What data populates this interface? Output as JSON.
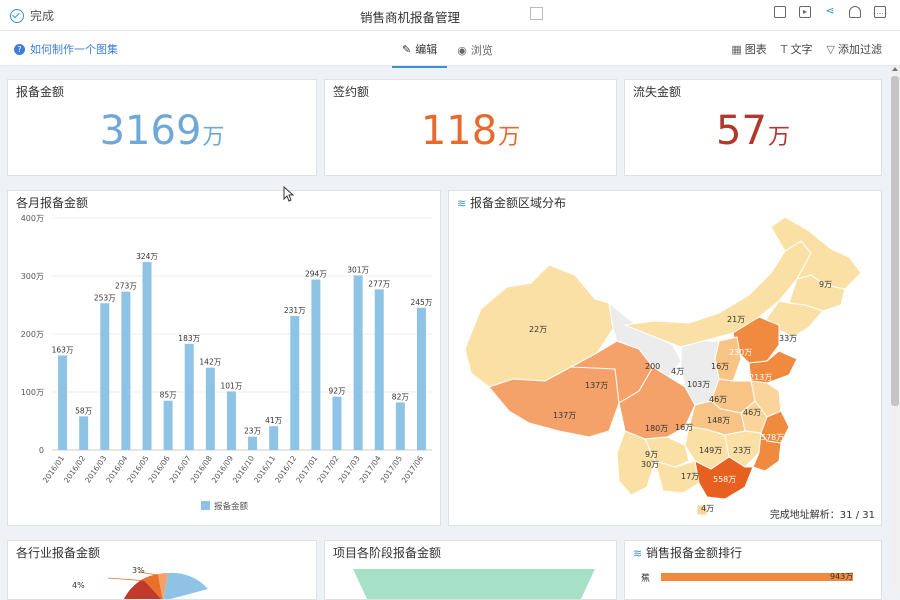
{
  "topbar": {
    "done_label": "完成",
    "title": "销售商机报备管理"
  },
  "subbar": {
    "help_link": "如何制作一个图集",
    "tabs": [
      {
        "label": "编辑",
        "active": true
      },
      {
        "label": "浏览",
        "active": false
      }
    ],
    "tools": {
      "chart_label": "图表",
      "text_label": "文字",
      "filter_label": "添加过滤"
    }
  },
  "kpis": [
    {
      "title": "报备金额",
      "value": "3169",
      "unit": "万",
      "color": "#6fa8d6"
    },
    {
      "title": "签约额",
      "value": "118",
      "unit": "万",
      "color": "#e8692e"
    },
    {
      "title": "流失金额",
      "value": "57",
      "unit": "万",
      "color": "#b0392b"
    }
  ],
  "monthly": {
    "title": "各月报备金额",
    "legend": "报备金额"
  },
  "chart_data": {
    "type": "bar",
    "title": "各月报备金额",
    "categories": [
      "2016/01",
      "2016/02",
      "2016/03",
      "2016/04",
      "2016/05",
      "2016/06",
      "2016/07",
      "2016/08",
      "2016/09",
      "2016/10",
      "2016/11",
      "2016/12",
      "2017/01",
      "2017/02",
      "2017/03",
      "2017/04",
      "2017/05",
      "2017/06"
    ],
    "series": [
      {
        "name": "报备金额",
        "values": [
          163,
          58,
          253,
          273,
          324,
          85,
          183,
          142,
          101,
          23,
          41,
          231,
          294,
          92,
          301,
          277,
          82,
          245
        ],
        "labels": [
          "163万",
          "58万",
          "253万",
          "273万",
          "324万",
          "85万",
          "183万",
          "142万",
          "101万",
          "23万",
          "41万",
          "231万",
          "294万",
          "92万",
          "301万",
          "277万",
          "82万",
          "245万"
        ]
      }
    ],
    "yticks": [
      "0",
      "100万",
      "200万",
      "300万",
      "400万"
    ],
    "ylim": [
      0,
      400
    ],
    "color": "#8fc3e6"
  },
  "map": {
    "title": "报备金额区域分布",
    "labels": [
      "22万",
      "9万",
      "21万",
      "33万",
      "230万",
      "213万",
      "200",
      "4万",
      "137万",
      "16万",
      "103万",
      "137万",
      "46万",
      "46万",
      "148万",
      "180万",
      "16万",
      "578万",
      "9万",
      "149万",
      "23万",
      "30万",
      "17万",
      "558万",
      "4万"
    ],
    "status": "完成地址解析：31 / 31"
  },
  "bottom": {
    "industry_title": "各行业报备金额",
    "industry_labels": [
      "3%",
      "4%"
    ],
    "stage_title": "项目各阶段报备金额",
    "rank_title": "销售报备金额排行",
    "rank_first_name": "蕉",
    "rank_first_value": "943万"
  }
}
